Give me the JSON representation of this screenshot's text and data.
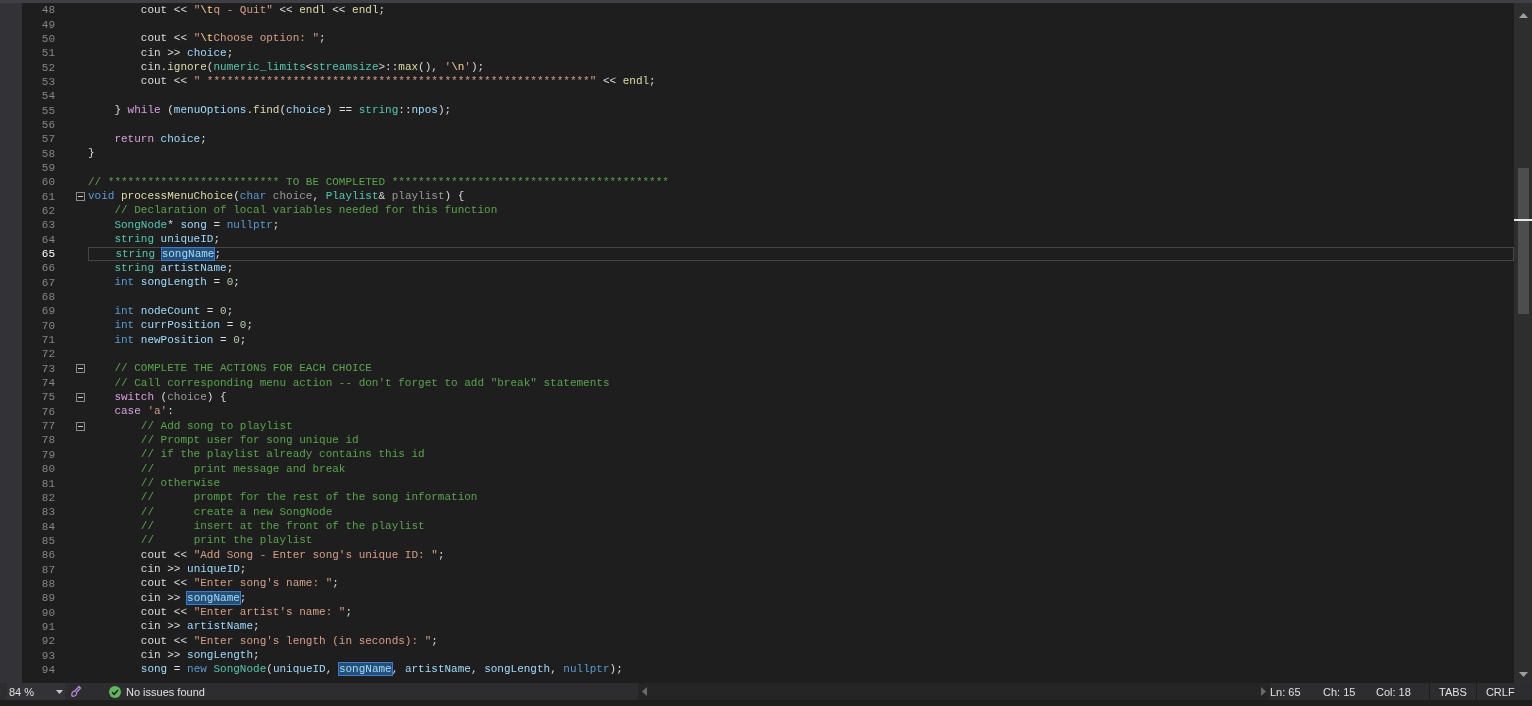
{
  "editor": {
    "lines": [
      {
        "number": "48",
        "fold": false,
        "current": false,
        "tokens": [
          {
            "text": "\t\tcout << ",
            "kind": "plain"
          },
          {
            "text": "\"",
            "kind": "string"
          },
          {
            "text": "\\t",
            "kind": "escape"
          },
          {
            "text": "q - Quit\"",
            "kind": "string"
          },
          {
            "text": " << ",
            "kind": "plain"
          },
          {
            "text": "endl",
            "kind": "function"
          },
          {
            "text": " << ",
            "kind": "plain"
          },
          {
            "text": "endl",
            "kind": "function"
          },
          {
            "text": ";",
            "kind": "plain"
          }
        ]
      },
      {
        "number": "49",
        "fold": false,
        "current": false
      },
      {
        "number": "50",
        "fold": false,
        "current": false,
        "tokens": [
          {
            "text": "\t\tcout << ",
            "kind": "plain"
          },
          {
            "text": "\"",
            "kind": "string"
          },
          {
            "text": "\\t",
            "kind": "escape"
          },
          {
            "text": "Choose option: \"",
            "kind": "string"
          },
          {
            "text": ";",
            "kind": "plain"
          }
        ]
      },
      {
        "number": "51",
        "fold": false,
        "current": false,
        "tokens": [
          {
            "text": "\t\tcin >> ",
            "kind": "plain"
          },
          {
            "text": "choice",
            "kind": "variable"
          },
          {
            "text": ";",
            "kind": "plain"
          }
        ]
      },
      {
        "number": "52",
        "fold": false,
        "current": false,
        "tokens": [
          {
            "text": "\t\tcin.",
            "kind": "plain"
          },
          {
            "text": "ignore",
            "kind": "function"
          },
          {
            "text": "(",
            "kind": "plain"
          },
          {
            "text": "numeric_limits",
            "kind": "type"
          },
          {
            "text": "<",
            "kind": "plain"
          },
          {
            "text": "streamsize",
            "kind": "type"
          },
          {
            "text": ">::",
            "kind": "plain"
          },
          {
            "text": "max",
            "kind": "function"
          },
          {
            "text": "(), ",
            "kind": "plain"
          },
          {
            "text": "'",
            "kind": "string"
          },
          {
            "text": "\\n",
            "kind": "escape"
          },
          {
            "text": "'",
            "kind": "string"
          },
          {
            "text": ");",
            "kind": "plain"
          }
        ]
      },
      {
        "number": "53",
        "fold": false,
        "current": false,
        "tokens": [
          {
            "text": "\t\tcout << ",
            "kind": "plain"
          },
          {
            "text": "\" **********************************************************\"",
            "kind": "string"
          },
          {
            "text": " << ",
            "kind": "plain"
          },
          {
            "text": "endl",
            "kind": "function"
          },
          {
            "text": ";",
            "kind": "plain"
          }
        ]
      },
      {
        "number": "54",
        "fold": false,
        "current": false
      },
      {
        "number": "55",
        "fold": false,
        "current": false,
        "tokens": [
          {
            "text": "\t} ",
            "kind": "plain"
          },
          {
            "text": "while",
            "kind": "control"
          },
          {
            "text": " (",
            "kind": "plain"
          },
          {
            "text": "menuOptions",
            "kind": "variable"
          },
          {
            "text": ".",
            "kind": "plain"
          },
          {
            "text": "find",
            "kind": "function"
          },
          {
            "text": "(",
            "kind": "plain"
          },
          {
            "text": "choice",
            "kind": "variable"
          },
          {
            "text": ") == ",
            "kind": "plain"
          },
          {
            "text": "string",
            "kind": "type"
          },
          {
            "text": "::",
            "kind": "plain"
          },
          {
            "text": "npos",
            "kind": "variable"
          },
          {
            "text": ");",
            "kind": "plain"
          }
        ]
      },
      {
        "number": "56",
        "fold": false,
        "current": false
      },
      {
        "number": "57",
        "fold": false,
        "current": false,
        "tokens": [
          {
            "text": "\treturn",
            "kind": "control"
          },
          {
            "text": " choice",
            "kind": "variable"
          },
          {
            "text": ";",
            "kind": "plain"
          }
        ]
      },
      {
        "number": "58",
        "fold": false,
        "current": false,
        "tokens": [
          {
            "text": "}",
            "kind": "plain"
          }
        ]
      },
      {
        "number": "59",
        "fold": false,
        "current": false
      },
      {
        "number": "60",
        "fold": false,
        "current": false,
        "tokens": [
          {
            "text": "// ************************** TO BE COMPLETED ******************************************",
            "kind": "comment"
          }
        ]
      },
      {
        "number": "61",
        "fold": true,
        "current": false,
        "tokens": [
          {
            "text": "void",
            "kind": "keyword"
          },
          {
            "text": " processMenuChoice",
            "kind": "function"
          },
          {
            "text": "(",
            "kind": "plain"
          },
          {
            "text": "char",
            "kind": "keyword"
          },
          {
            "text": " choice",
            "kind": "parameter"
          },
          {
            "text": ", ",
            "kind": "plain"
          },
          {
            "text": "Playlist",
            "kind": "type"
          },
          {
            "text": "& ",
            "kind": "plain"
          },
          {
            "text": "playlist",
            "kind": "parameter"
          },
          {
            "text": ") {",
            "kind": "plain"
          }
        ]
      },
      {
        "number": "62",
        "fold": false,
        "current": false,
        "tokens": [
          {
            "text": "\t// Declaration of local variables needed for this function",
            "kind": "comment"
          }
        ]
      },
      {
        "number": "63",
        "fold": false,
        "current": false,
        "tokens": [
          {
            "text": "\tSongNode",
            "kind": "type"
          },
          {
            "text": "* ",
            "kind": "plain"
          },
          {
            "text": "song",
            "kind": "variable"
          },
          {
            "text": " = ",
            "kind": "plain"
          },
          {
            "text": "nullptr",
            "kind": "keyword"
          },
          {
            "text": ";",
            "kind": "plain"
          }
        ]
      },
      {
        "number": "64",
        "fold": false,
        "current": false,
        "tokens": [
          {
            "text": "\tstring",
            "kind": "type"
          },
          {
            "text": " uniqueID",
            "kind": "variable"
          },
          {
            "text": ";",
            "kind": "plain"
          }
        ]
      },
      {
        "number": "65",
        "fold": false,
        "current": true,
        "tokens": [
          {
            "text": "\tstring ",
            "kind": "type"
          },
          {
            "text": "songName",
            "kind": "highlight"
          },
          {
            "text": ";",
            "kind": "plain"
          }
        ]
      },
      {
        "number": "66",
        "fold": false,
        "current": false,
        "tokens": [
          {
            "text": "\tstring",
            "kind": "type"
          },
          {
            "text": " artistName",
            "kind": "variable"
          },
          {
            "text": ";",
            "kind": "plain"
          }
        ]
      },
      {
        "number": "67",
        "fold": false,
        "current": false,
        "tokens": [
          {
            "text": "\tint",
            "kind": "keyword"
          },
          {
            "text": " songLength",
            "kind": "variable"
          },
          {
            "text": " = ",
            "kind": "plain"
          },
          {
            "text": "0",
            "kind": "number"
          },
          {
            "text": ";",
            "kind": "plain"
          }
        ]
      },
      {
        "number": "68",
        "fold": false,
        "current": false
      },
      {
        "number": "69",
        "fold": false,
        "current": false,
        "tokens": [
          {
            "text": "\tint",
            "kind": "keyword"
          },
          {
            "text": " nodeCount",
            "kind": "variable"
          },
          {
            "text": " = ",
            "kind": "plain"
          },
          {
            "text": "0",
            "kind": "number"
          },
          {
            "text": ";",
            "kind": "plain"
          }
        ]
      },
      {
        "number": "70",
        "fold": false,
        "current": false,
        "tokens": [
          {
            "text": "\tint",
            "kind": "keyword"
          },
          {
            "text": " currPosition",
            "kind": "variable"
          },
          {
            "text": " = ",
            "kind": "plain"
          },
          {
            "text": "0",
            "kind": "number"
          },
          {
            "text": ";",
            "kind": "plain"
          }
        ]
      },
      {
        "number": "71",
        "fold": false,
        "current": false,
        "tokens": [
          {
            "text": "\tint",
            "kind": "keyword"
          },
          {
            "text": " newPosition",
            "kind": "variable"
          },
          {
            "text": " = ",
            "kind": "plain"
          },
          {
            "text": "0",
            "kind": "number"
          },
          {
            "text": ";",
            "kind": "plain"
          }
        ]
      },
      {
        "number": "72",
        "fold": false,
        "current": false
      },
      {
        "number": "73",
        "fold": true,
        "current": false,
        "tokens": [
          {
            "text": "\t// COMPLETE THE ACTIONS FOR EACH CHOICE",
            "kind": "comment"
          }
        ]
      },
      {
        "number": "74",
        "fold": false,
        "current": false,
        "tokens": [
          {
            "text": "\t// Call corresponding menu action -- don't forget to add \"break\" statements",
            "kind": "comment"
          }
        ]
      },
      {
        "number": "75",
        "fold": true,
        "current": false,
        "tokens": [
          {
            "text": "\tswitch",
            "kind": "control"
          },
          {
            "text": " (",
            "kind": "plain"
          },
          {
            "text": "choice",
            "kind": "parameter"
          },
          {
            "text": ") {",
            "kind": "plain"
          }
        ]
      },
      {
        "number": "76",
        "fold": false,
        "current": false,
        "tokens": [
          {
            "text": "\tcase",
            "kind": "control"
          },
          {
            "text": " 'a'",
            "kind": "string"
          },
          {
            "text": ":",
            "kind": "plain"
          }
        ]
      },
      {
        "number": "77",
        "fold": true,
        "current": false,
        "tokens": [
          {
            "text": "\t\t// Add song to playlist",
            "kind": "comment"
          }
        ]
      },
      {
        "number": "78",
        "fold": false,
        "current": false,
        "tokens": [
          {
            "text": "\t\t// Prompt user for song unique id",
            "kind": "comment"
          }
        ]
      },
      {
        "number": "79",
        "fold": false,
        "current": false,
        "tokens": [
          {
            "text": "\t\t// if the playlist already contains this id",
            "kind": "comment"
          }
        ]
      },
      {
        "number": "80",
        "fold": false,
        "current": false,
        "tokens": [
          {
            "text": "\t\t//\t\tprint message and break",
            "kind": "comment"
          }
        ]
      },
      {
        "number": "81",
        "fold": false,
        "current": false,
        "tokens": [
          {
            "text": "\t\t// otherwise",
            "kind": "comment"
          }
        ]
      },
      {
        "number": "82",
        "fold": false,
        "current": false,
        "tokens": [
          {
            "text": "\t\t//\t\tprompt for the rest of the song information",
            "kind": "comment"
          }
        ]
      },
      {
        "number": "83",
        "fold": false,
        "current": false,
        "tokens": [
          {
            "text": "\t\t//\t\tcreate a new SongNode",
            "kind": "comment"
          }
        ]
      },
      {
        "number": "84",
        "fold": false,
        "current": false,
        "tokens": [
          {
            "text": "\t\t//\t\tinsert at the front of the playlist",
            "kind": "comment"
          }
        ]
      },
      {
        "number": "85",
        "fold": false,
        "current": false,
        "tokens": [
          {
            "text": "\t\t//\t\tprint the playlist",
            "kind": "comment"
          }
        ]
      },
      {
        "number": "86",
        "fold": false,
        "current": false,
        "tokens": [
          {
            "text": "\t\tcout << ",
            "kind": "plain"
          },
          {
            "text": "\"Add Song - Enter song's unique ID: \"",
            "kind": "string"
          },
          {
            "text": ";",
            "kind": "plain"
          }
        ]
      },
      {
        "number": "87",
        "fold": false,
        "current": false,
        "tokens": [
          {
            "text": "\t\tcin >> ",
            "kind": "plain"
          },
          {
            "text": "uniqueID",
            "kind": "variable"
          },
          {
            "text": ";",
            "kind": "plain"
          }
        ]
      },
      {
        "number": "88",
        "fold": false,
        "current": false,
        "tokens": [
          {
            "text": "\t\tcout << ",
            "kind": "plain"
          },
          {
            "text": "\"Enter song's name: \"",
            "kind": "string"
          },
          {
            "text": ";",
            "kind": "plain"
          }
        ]
      },
      {
        "number": "89",
        "fold": false,
        "current": false,
        "tokens": [
          {
            "text": "\t\tcin >> ",
            "kind": "plain"
          },
          {
            "text": "songName",
            "kind": "highlight"
          },
          {
            "text": ";",
            "kind": "plain"
          }
        ]
      },
      {
        "number": "90",
        "fold": false,
        "current": false,
        "tokens": [
          {
            "text": "\t\tcout << ",
            "kind": "plain"
          },
          {
            "text": "\"Enter artist's name: \"",
            "kind": "string"
          },
          {
            "text": ";",
            "kind": "plain"
          }
        ]
      },
      {
        "number": "91",
        "fold": false,
        "current": false,
        "tokens": [
          {
            "text": "\t\tcin >> ",
            "kind": "plain"
          },
          {
            "text": "artistName",
            "kind": "variable"
          },
          {
            "text": ";",
            "kind": "plain"
          }
        ]
      },
      {
        "number": "92",
        "fold": false,
        "current": false,
        "tokens": [
          {
            "text": "\t\tcout << ",
            "kind": "plain"
          },
          {
            "text": "\"Enter song's length (in seconds): \"",
            "kind": "string"
          },
          {
            "text": ";",
            "kind": "plain"
          }
        ]
      },
      {
        "number": "93",
        "fold": false,
        "current": false,
        "tokens": [
          {
            "text": "\t\tcin >> ",
            "kind": "plain"
          },
          {
            "text": "songLength",
            "kind": "variable"
          },
          {
            "text": ";",
            "kind": "plain"
          }
        ]
      },
      {
        "number": "94",
        "fold": false,
        "current": false,
        "tokens": [
          {
            "text": "\t\tsong",
            "kind": "variable"
          },
          {
            "text": " = ",
            "kind": "plain"
          },
          {
            "text": "new",
            "kind": "keyword"
          },
          {
            "text": " SongNode",
            "kind": "type"
          },
          {
            "text": "(",
            "kind": "plain"
          },
          {
            "text": "uniqueID",
            "kind": "variable"
          },
          {
            "text": ", ",
            "kind": "plain"
          },
          {
            "text": "songName",
            "kind": "highlight"
          },
          {
            "text": ", ",
            "kind": "plain"
          },
          {
            "text": "artistName",
            "kind": "variable"
          },
          {
            "text": ", ",
            "kind": "plain"
          },
          {
            "text": "songLength",
            "kind": "variable"
          },
          {
            "text": ", ",
            "kind": "plain"
          },
          {
            "text": "nullptr",
            "kind": "keyword"
          },
          {
            "text": ");",
            "kind": "plain"
          }
        ]
      }
    ]
  },
  "status_bar": {
    "zoom": "84 %",
    "issues": "No issues found",
    "position": [
      "Ln: 65",
      "Ch: 15",
      "Col: 18"
    ],
    "indentation": "TABS",
    "line_ending": "CRLF"
  }
}
